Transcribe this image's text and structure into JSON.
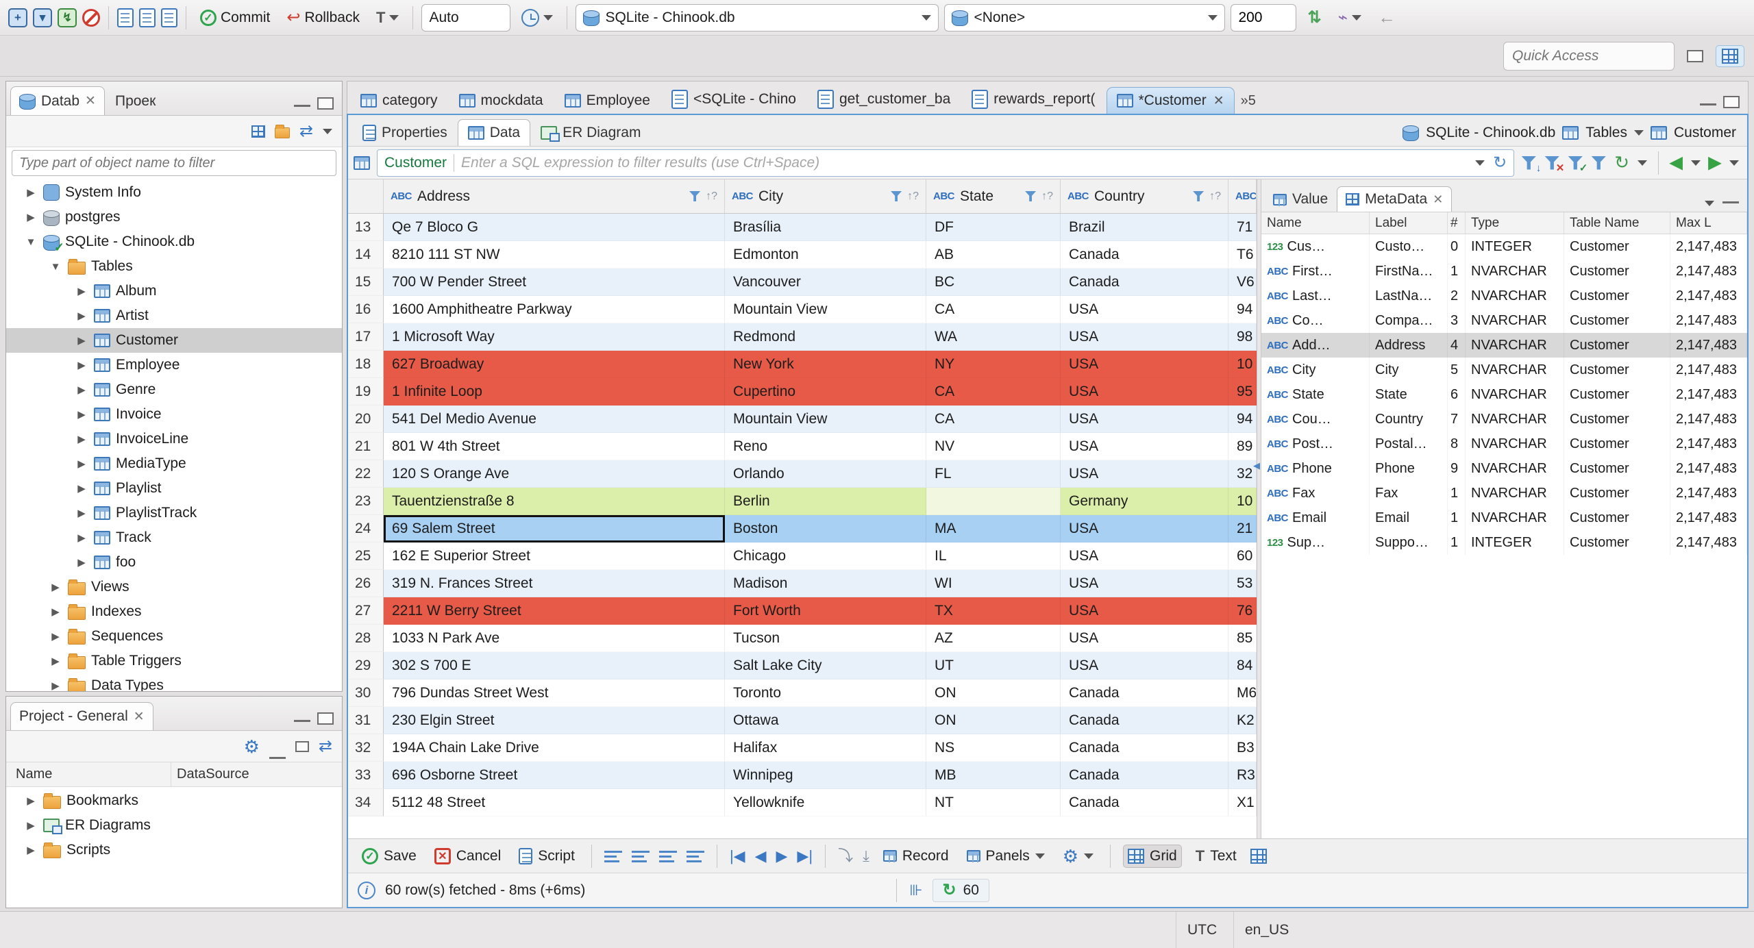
{
  "toolbar": {
    "commit": "Commit",
    "rollback": "Rollback",
    "tx_mode": "T",
    "auto": "Auto",
    "db_combo": "SQLite - Chinook.db",
    "schema_combo": "<None>",
    "fetch_size": "200",
    "quick_access_placeholder": "Quick Access"
  },
  "nav": {
    "tab_database": "Datab",
    "tab_projects": "Проек",
    "filter_placeholder": "Type part of object name to filter",
    "tree": [
      {
        "label": "System Info",
        "cls": "lvl0",
        "exp": "exp-closed",
        "icon": "infic"
      },
      {
        "label": "postgres",
        "cls": "lvl0",
        "exp": "exp-closed",
        "icon": "dbicon gray"
      },
      {
        "label": "SQLite - Chinook.db",
        "cls": "lvl0",
        "exp": "exp-open",
        "icon": "dbicon check"
      },
      {
        "label": "Tables",
        "cls": "lvl1",
        "exp": "exp-open",
        "icon": "foldic"
      },
      {
        "label": "Album",
        "cls": "lvl2",
        "exp": "exp-closed",
        "icon": "tblic"
      },
      {
        "label": "Artist",
        "cls": "lvl2",
        "exp": "exp-closed",
        "icon": "tblic"
      },
      {
        "label": "Customer",
        "cls": "lvl2 sel",
        "exp": "exp-closed",
        "icon": "tblic"
      },
      {
        "label": "Employee",
        "cls": "lvl2",
        "exp": "exp-closed",
        "icon": "tblic"
      },
      {
        "label": "Genre",
        "cls": "lvl2",
        "exp": "exp-closed",
        "icon": "tblic"
      },
      {
        "label": "Invoice",
        "cls": "lvl2",
        "exp": "exp-closed",
        "icon": "tblic"
      },
      {
        "label": "InvoiceLine",
        "cls": "lvl2",
        "exp": "exp-closed",
        "icon": "tblic"
      },
      {
        "label": "MediaType",
        "cls": "lvl2",
        "exp": "exp-closed",
        "icon": "tblic"
      },
      {
        "label": "Playlist",
        "cls": "lvl2",
        "exp": "exp-closed",
        "icon": "tblic"
      },
      {
        "label": "PlaylistTrack",
        "cls": "lvl2",
        "exp": "exp-closed",
        "icon": "tblic"
      },
      {
        "label": "Track",
        "cls": "lvl2",
        "exp": "exp-closed",
        "icon": "tblic"
      },
      {
        "label": "foo",
        "cls": "lvl2",
        "exp": "exp-closed",
        "icon": "tblic"
      },
      {
        "label": "Views",
        "cls": "lvl1",
        "exp": "exp-closed",
        "icon": "foldic"
      },
      {
        "label": "Indexes",
        "cls": "lvl1",
        "exp": "exp-closed",
        "icon": "foldic"
      },
      {
        "label": "Sequences",
        "cls": "lvl1",
        "exp": "exp-closed",
        "icon": "foldic"
      },
      {
        "label": "Table Triggers",
        "cls": "lvl1",
        "exp": "exp-closed",
        "icon": "foldic"
      },
      {
        "label": "Data Types",
        "cls": "lvl1",
        "exp": "exp-closed",
        "icon": "foldic"
      }
    ]
  },
  "project": {
    "tab": "Project - General",
    "col_name": "Name",
    "col_datasource": "DataSource",
    "items": [
      {
        "label": "Bookmarks",
        "cls": "lvl0",
        "exp": "exp-closed",
        "icon": "foldic"
      },
      {
        "label": "ER Diagrams",
        "cls": "lvl0",
        "exp": "exp-closed",
        "icon": "erdic"
      },
      {
        "label": "Scripts",
        "cls": "lvl0",
        "exp": "exp-closed",
        "icon": "foldic"
      }
    ]
  },
  "editor": {
    "tabs": [
      {
        "label": "category",
        "cls": "",
        "icon": "tblic"
      },
      {
        "label": "mockdata",
        "cls": "",
        "icon": "tblic"
      },
      {
        "label": "Employee",
        "cls": "",
        "icon": "tblic"
      },
      {
        "label": "<SQLite - Chino",
        "cls": "",
        "icon": "doc"
      },
      {
        "label": "get_customer_ba",
        "cls": "",
        "icon": "doc"
      },
      {
        "label": "rewards_report(",
        "cls": "",
        "icon": "doc"
      },
      {
        "label": "*Customer",
        "cls": "active",
        "icon": "tblic"
      }
    ],
    "overflow": "»5"
  },
  "subtabs": {
    "properties": "Properties",
    "data": "Data",
    "erdiagram": "ER Diagram",
    "right_db": "SQLite - Chinook.db",
    "right_tables": "Tables",
    "right_entity": "Customer"
  },
  "filter_bar": {
    "entity": "Customer",
    "placeholder": "Enter a SQL expression to filter results (use Ctrl+Space)"
  },
  "grid": {
    "type_icon": "ABC",
    "sort_hint": "↑?",
    "columns": [
      {
        "label": "Address"
      },
      {
        "label": "City"
      },
      {
        "label": "State"
      },
      {
        "label": "Country"
      }
    ],
    "rows": [
      {
        "num": "13",
        "address": "Qe 7 Bloco G",
        "city": "Brasília",
        "state": "DF",
        "country": "Brazil",
        "postal": "71",
        "cls": "alt"
      },
      {
        "num": "14",
        "address": "8210 111 ST NW",
        "city": "Edmonton",
        "state": "AB",
        "country": "Canada",
        "postal": "T6",
        "cls": ""
      },
      {
        "num": "15",
        "address": "700 W Pender Street",
        "city": "Vancouver",
        "state": "BC",
        "country": "Canada",
        "postal": "V6",
        "cls": "alt"
      },
      {
        "num": "16",
        "address": "1600 Amphitheatre Parkway",
        "city": "Mountain View",
        "state": "CA",
        "country": "USA",
        "postal": "94",
        "cls": ""
      },
      {
        "num": "17",
        "address": "1 Microsoft Way",
        "city": "Redmond",
        "state": "WA",
        "country": "USA",
        "postal": "98",
        "cls": "alt"
      },
      {
        "num": "18",
        "address": "627 Broadway",
        "city": "New York",
        "state": "NY",
        "country": "USA",
        "postal": "10",
        "cls": "red"
      },
      {
        "num": "19",
        "address": "1 Infinite Loop",
        "city": "Cupertino",
        "state": "CA",
        "country": "USA",
        "postal": "95",
        "cls": "red"
      },
      {
        "num": "20",
        "address": "541 Del Medio Avenue",
        "city": "Mountain View",
        "state": "CA",
        "country": "USA",
        "postal": "94",
        "cls": "alt"
      },
      {
        "num": "21",
        "address": "801 W 4th Street",
        "city": "Reno",
        "state": "NV",
        "country": "USA",
        "postal": "89",
        "cls": ""
      },
      {
        "num": "22",
        "address": "120 S Orange Ave",
        "city": "Orlando",
        "state": "FL",
        "country": "USA",
        "postal": "32",
        "cls": "alt"
      },
      {
        "num": "23",
        "address": "Tauentzienstraße 8",
        "city": "Berlin",
        "state": "",
        "country": "Germany",
        "postal": "10",
        "cls": "green"
      },
      {
        "num": "24",
        "address": "69 Salem Street",
        "city": "Boston",
        "state": "MA",
        "country": "USA",
        "postal": "21",
        "cls": "sel"
      },
      {
        "num": "25",
        "address": "162 E Superior Street",
        "city": "Chicago",
        "state": "IL",
        "country": "USA",
        "postal": "60",
        "cls": ""
      },
      {
        "num": "26",
        "address": "319 N. Frances Street",
        "city": "Madison",
        "state": "WI",
        "country": "USA",
        "postal": "53",
        "cls": "alt"
      },
      {
        "num": "27",
        "address": "2211 W Berry Street",
        "city": "Fort Worth",
        "state": "TX",
        "country": "USA",
        "postal": "76",
        "cls": "red"
      },
      {
        "num": "28",
        "address": "1033 N Park Ave",
        "city": "Tucson",
        "state": "AZ",
        "country": "USA",
        "postal": "85",
        "cls": ""
      },
      {
        "num": "29",
        "address": "302 S 700 E",
        "city": "Salt Lake City",
        "state": "UT",
        "country": "USA",
        "postal": "84",
        "cls": "alt"
      },
      {
        "num": "30",
        "address": "796 Dundas Street West",
        "city": "Toronto",
        "state": "ON",
        "country": "Canada",
        "postal": "M6",
        "cls": ""
      },
      {
        "num": "31",
        "address": "230 Elgin Street",
        "city": "Ottawa",
        "state": "ON",
        "country": "Canada",
        "postal": "K2",
        "cls": "alt"
      },
      {
        "num": "32",
        "address": "194A Chain Lake Drive",
        "city": "Halifax",
        "state": "NS",
        "country": "Canada",
        "postal": "B3",
        "cls": ""
      },
      {
        "num": "33",
        "address": "696 Osborne Street",
        "city": "Winnipeg",
        "state": "MB",
        "country": "Canada",
        "postal": "R3",
        "cls": "alt"
      },
      {
        "num": "34",
        "address": "5112 48 Street",
        "city": "Yellowknife",
        "state": "NT",
        "country": "Canada",
        "postal": "X1",
        "cls": ""
      }
    ]
  },
  "meta": {
    "tab_value": "Value",
    "tab_metadata": "MetaData",
    "columns": {
      "name": "Name",
      "label": "Label",
      "ord": "#",
      "type": "Type",
      "table": "Table Name",
      "max": "Max L"
    },
    "rows": [
      {
        "g": "123",
        "gc": "numg",
        "name": "Cus…",
        "label": "Custo…",
        "ord": "0",
        "type": "INTEGER",
        "table": "Customer",
        "max": "2,147,483",
        "cls": ""
      },
      {
        "g": "ABC",
        "gc": "abcg",
        "name": "First…",
        "label": "FirstNa…",
        "ord": "1",
        "type": "NVARCHAR",
        "table": "Customer",
        "max": "2,147,483",
        "cls": ""
      },
      {
        "g": "ABC",
        "gc": "abcg",
        "name": "Last…",
        "label": "LastNa…",
        "ord": "2",
        "type": "NVARCHAR",
        "table": "Customer",
        "max": "2,147,483",
        "cls": ""
      },
      {
        "g": "ABC",
        "gc": "abcg",
        "name": "Co…",
        "label": "Compa…",
        "ord": "3",
        "type": "NVARCHAR",
        "table": "Customer",
        "max": "2,147,483",
        "cls": ""
      },
      {
        "g": "ABC",
        "gc": "abcg",
        "name": "Add…",
        "label": "Address",
        "ord": "4",
        "type": "NVARCHAR",
        "table": "Customer",
        "max": "2,147,483",
        "cls": "sel"
      },
      {
        "g": "ABC",
        "gc": "abcg",
        "name": "City",
        "label": "City",
        "ord": "5",
        "type": "NVARCHAR",
        "table": "Customer",
        "max": "2,147,483",
        "cls": ""
      },
      {
        "g": "ABC",
        "gc": "abcg",
        "name": "State",
        "label": "State",
        "ord": "6",
        "type": "NVARCHAR",
        "table": "Customer",
        "max": "2,147,483",
        "cls": ""
      },
      {
        "g": "ABC",
        "gc": "abcg",
        "name": "Cou…",
        "label": "Country",
        "ord": "7",
        "type": "NVARCHAR",
        "table": "Customer",
        "max": "2,147,483",
        "cls": ""
      },
      {
        "g": "ABC",
        "gc": "abcg",
        "name": "Post…",
        "label": "Postal…",
        "ord": "8",
        "type": "NVARCHAR",
        "table": "Customer",
        "max": "2,147,483",
        "cls": ""
      },
      {
        "g": "ABC",
        "gc": "abcg",
        "name": "Phone",
        "label": "Phone",
        "ord": "9",
        "type": "NVARCHAR",
        "table": "Customer",
        "max": "2,147,483",
        "cls": ""
      },
      {
        "g": "ABC",
        "gc": "abcg",
        "name": "Fax",
        "label": "Fax",
        "ord": "1",
        "type": "NVARCHAR",
        "table": "Customer",
        "max": "2,147,483",
        "cls": ""
      },
      {
        "g": "ABC",
        "gc": "abcg",
        "name": "Email",
        "label": "Email",
        "ord": "1",
        "type": "NVARCHAR",
        "table": "Customer",
        "max": "2,147,483",
        "cls": ""
      },
      {
        "g": "123",
        "gc": "numg",
        "name": "Sup…",
        "label": "Suppo…",
        "ord": "1",
        "type": "INTEGER",
        "table": "Customer",
        "max": "2,147,483",
        "cls": ""
      }
    ]
  },
  "bottom_toolbar": {
    "save": "Save",
    "cancel": "Cancel",
    "script": "Script",
    "record": "Record",
    "panels": "Panels",
    "grid": "Grid",
    "text": "Text"
  },
  "status_line": {
    "text": "60 row(s) fetched - 8ms (+6ms)",
    "count": "60"
  },
  "statusbar": {
    "tz": "UTC",
    "locale": "en_US"
  }
}
